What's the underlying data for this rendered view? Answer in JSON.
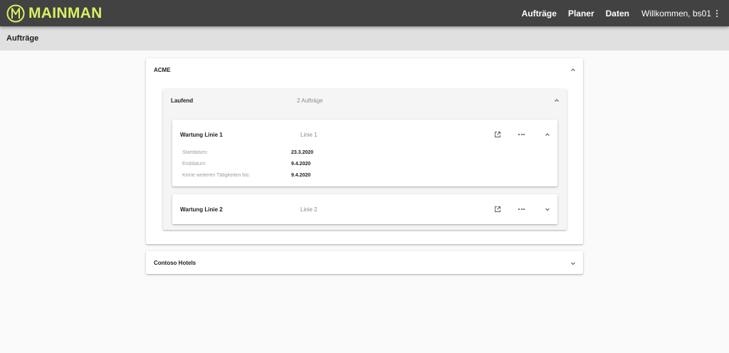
{
  "app": {
    "brand": "MAINMAN",
    "brand_color": "#d9f063",
    "logo_icon": "m-circle-logo"
  },
  "nav": {
    "orders": "Aufträge",
    "planner": "Planer",
    "data": "Daten",
    "user": "Willkommen, bs01",
    "menu_icon": "kebab-vertical-icon"
  },
  "page": {
    "title": "Aufträge"
  },
  "customers": [
    {
      "name": "ACME",
      "expanded": true,
      "groups": [
        {
          "status": "Laufend",
          "count_label": "2 Aufträge",
          "orders": [
            {
              "title": "Wartung Linie 1",
              "line": "Linie 1",
              "expanded": true,
              "details": [
                {
                  "label": "Startdatum:",
                  "value": "23.3.2020"
                },
                {
                  "label": "Enddatum:",
                  "value": "9.4.2020"
                },
                {
                  "label": "Keine weiteren Tätigkeiten bis:",
                  "value": "9.4.2020"
                }
              ]
            },
            {
              "title": "Wartung Linie 2",
              "line": "Linie 2",
              "expanded": false
            }
          ]
        }
      ]
    },
    {
      "name": "Contoso Hotels",
      "expanded": false
    }
  ],
  "icons": {
    "open": "open-in-new-icon",
    "more": "more-horizontal-icon",
    "expand": "chevron-down-icon",
    "collapse": "chevron-up-icon"
  }
}
